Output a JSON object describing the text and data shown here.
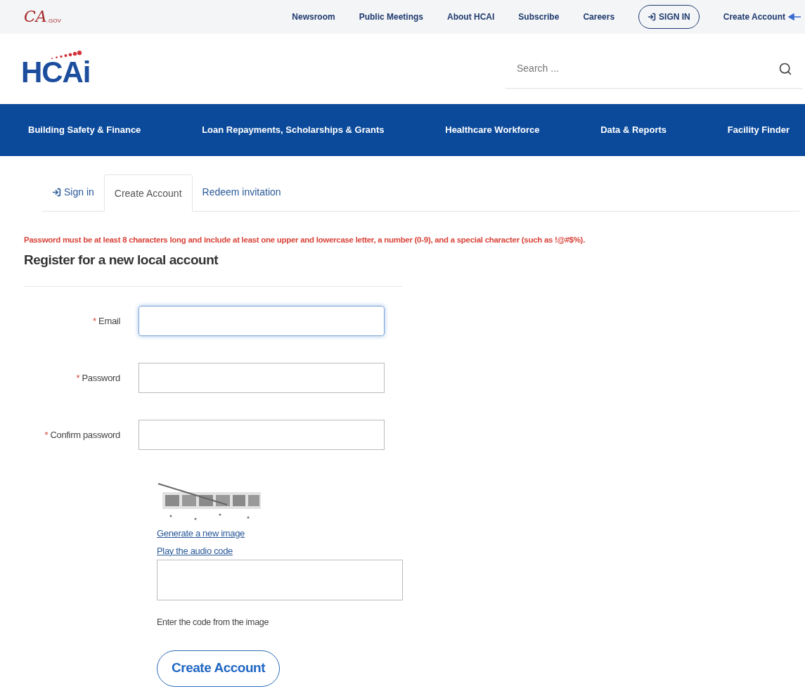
{
  "utility_bar": {
    "logo": {
      "main": "CA",
      "suffix": ".GOV"
    },
    "links": [
      {
        "label": "Newsroom",
        "kind": "link"
      },
      {
        "label": "Public Meetings",
        "kind": "link"
      },
      {
        "label": "About HCAI",
        "kind": "link"
      },
      {
        "label": "Subscribe",
        "kind": "link"
      },
      {
        "label": "Careers",
        "kind": "link"
      },
      {
        "label": "SIGN IN",
        "kind": "button"
      },
      {
        "label": "Create Account",
        "kind": "link"
      }
    ]
  },
  "header": {
    "logo": "HCAi",
    "search": {
      "placeholder": "Search ..."
    }
  },
  "main_nav": [
    "Building Safety & Finance",
    "Loan Repayments, Scholarships & Grants",
    "Healthcare Workforce",
    "Data & Reports",
    "Facility Finder"
  ],
  "tabs": [
    {
      "label": "Sign in",
      "selected": false,
      "kind": "signin"
    },
    {
      "label": "Create Account",
      "selected": true,
      "kind": "plain"
    },
    {
      "label": "Redeem invitation",
      "selected": false,
      "kind": "plain"
    }
  ],
  "password_notice": "Password must be at least 8 characters long and include at least one upper and lowercase letter, a number (0-9), and a special character (such as !@#$%).",
  "form": {
    "title": "Register for a new local account",
    "fields": [
      {
        "label": "Email",
        "required": "*",
        "focused": true
      },
      {
        "label": "Password",
        "required": "*",
        "focused": false
      },
      {
        "label": "Confirm password",
        "required": "*",
        "focused": false
      }
    ],
    "captcha": {
      "links": [
        "Generate a new image",
        "Play the audio code"
      ],
      "hint": "Enter the code from the image"
    },
    "submit": "Create Account"
  }
}
